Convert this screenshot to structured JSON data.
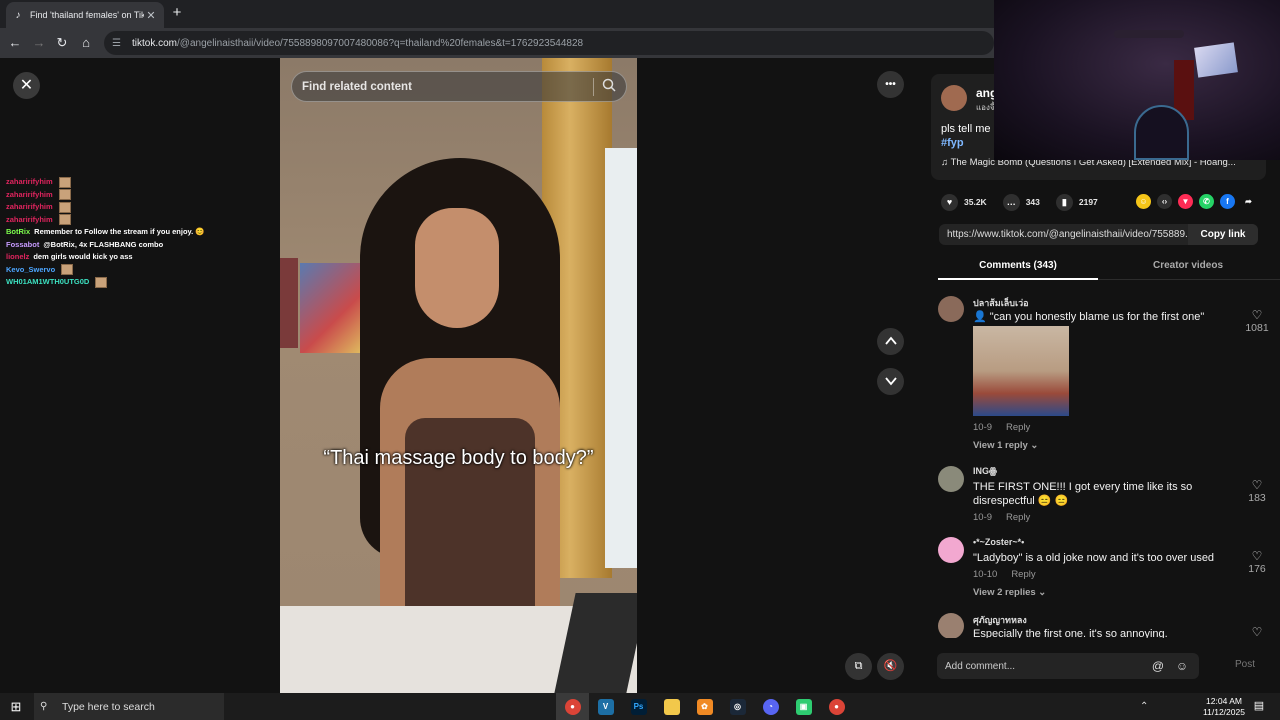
{
  "browser": {
    "tab_title": "Find 'thailand females' on TikTo",
    "tab_close": "✕",
    "new_tab": "+",
    "url_domain": "tiktok.com",
    "url_rest": "/@angelinaisthaii/video/7558898097007480086?q=thailand%20females&t=1762923544828"
  },
  "page": {
    "close": "✕",
    "find_placeholder": "Find related content",
    "more": "•••",
    "caption": "“Thai massage body to body?”"
  },
  "chat": [
    {
      "user": "zaharirifyhim",
      "msg": "",
      "color": "#e0245e"
    },
    {
      "user": "zaharirifyhim",
      "msg": "",
      "color": "#e0245e"
    },
    {
      "user": "zaharirifyhim",
      "msg": "",
      "color": "#e0245e"
    },
    {
      "user": "zaharirifyhim",
      "msg": "",
      "color": "#e0245e"
    },
    {
      "user": "BotRix",
      "msg": "Remember to Follow the stream if you enjoy. 😊",
      "color": "#7dff4d"
    },
    {
      "user": "Fossabot",
      "msg": "@BotRix, 4x FLASHBANG combo",
      "color": "#c79bff"
    },
    {
      "user": "lionelz",
      "msg": "dem girls would kick yo ass",
      "color": "#e0245e"
    },
    {
      "user": "Kevo_Swervo",
      "msg": "",
      "color": "#4da6ff"
    },
    {
      "user": "WH01AM1WTH0UTG0D",
      "msg": "",
      "color": "#3ce0c0"
    }
  ],
  "author": {
    "name": "ang",
    "sub": "แองจี้",
    "desc": "pls tell me",
    "tag": "#fyp",
    "music": "The Magic Bomb (Questions I Get Asked) [Extended Mix] - Hoang..."
  },
  "stats": {
    "likes": "35.2K",
    "comments": "343",
    "saves": "2197"
  },
  "link": {
    "url": "https://www.tiktok.com/@angelinaisthaii/video/755889...",
    "copy": "Copy link"
  },
  "tabs": {
    "comments": "Comments (343)",
    "creator": "Creator videos"
  },
  "comments": [
    {
      "name": "ปลาส้มเล็บเว่อ",
      "text": "👤 \"can you honestly blame us for the first one\"",
      "date": "10-9",
      "reply": "Reply",
      "likes": "1081",
      "more": "View 1 reply ⌄"
    },
    {
      "name": "INGꙮ",
      "text": "THE FIRST ONE!!! I got every time like its so disrespectful 😑 😑",
      "date": "10-9",
      "reply": "Reply",
      "likes": "183"
    },
    {
      "name": "•*~Zoster~*•",
      "text": "\"Ladyboy\" is a old joke now and it's too over used",
      "date": "10-10",
      "reply": "Reply",
      "likes": "176",
      "more": "View 2 replies ⌄"
    },
    {
      "name": "ศุภัญญาทหลง",
      "text": "Especially the first one. it's so annoying.",
      "date": "",
      "reply": "",
      "likes": ""
    }
  ],
  "add_comment": {
    "placeholder": "Add comment...",
    "post": "Post"
  },
  "taskbar": {
    "search": "Type here to search",
    "time": "12:04 AM",
    "date": "11/12/2025"
  }
}
